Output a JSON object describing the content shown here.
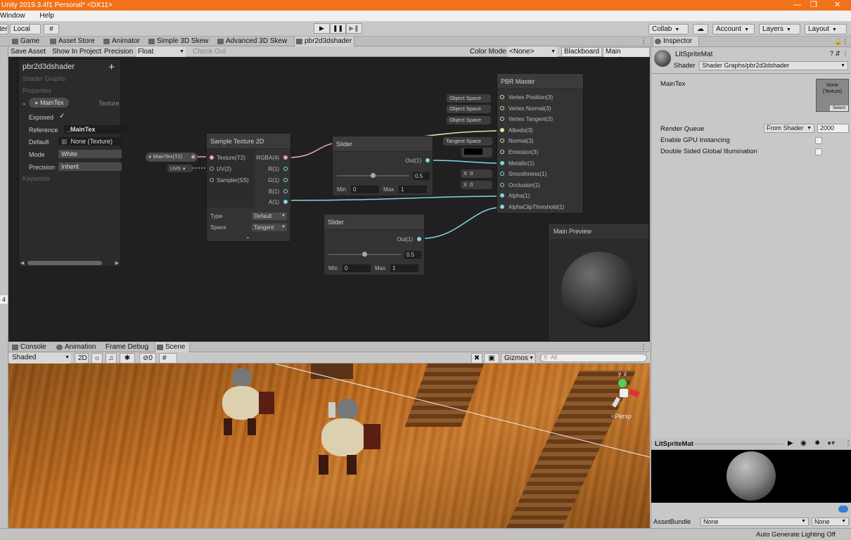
{
  "window": {
    "title": "Unity 2019.3.4f1 Personal* <DX11>"
  },
  "menu": [
    "Window",
    "Help"
  ],
  "toolbar": {
    "left_label": "ter",
    "local": "Local",
    "collab": "Collab",
    "account": "Account",
    "layers": "Layers",
    "layout": "Layout"
  },
  "tabs": [
    "Game",
    "Asset Store",
    "Animator",
    "Simple 3D Skew",
    "Advanced 3D Skew",
    "pbr2d3dshader"
  ],
  "sg_toolbar": {
    "save": "Save Asset",
    "show": "Show In Project",
    "precision_label": "Precision",
    "precision_value": "Float",
    "checkout": "Check Out",
    "color_mode_label": "Color Mode",
    "color_mode_value": "<None>",
    "blackboard": "Blackboard",
    "main_preview": "Main Preview"
  },
  "blackboard": {
    "title": "pbr2d3dshader",
    "subtitle": "Shader Graphs",
    "section": "Properties",
    "property_name": "MainTex",
    "property_type": "Texture",
    "exposed_label": "Exposed",
    "reference_label": "Reference",
    "reference_value": "_MainTex",
    "default_label": "Default",
    "default_value": "None (Texture)",
    "mode_label": "Mode",
    "mode_value": "White",
    "precision_label": "Precision",
    "precision_value": "Inherit",
    "keywords": "Keywords"
  },
  "nodes": {
    "maintex_pill": "MainTex(T2)",
    "uv_pill": "UV0",
    "sample": {
      "title": "Sample Texture 2D",
      "in": [
        "Texture(T2)",
        "UV(2)",
        "Sampler(SS)"
      ],
      "out": [
        "RGBA(4)",
        "R(1)",
        "G(1)",
        "B(1)",
        "A(1)"
      ],
      "type_label": "Type",
      "type_value": "Default",
      "space_label": "Space",
      "space_value": "Tangent"
    },
    "slider1": {
      "title": "Slider",
      "out": "Out(1)",
      "value": "0.5",
      "min_label": "Min",
      "min": "0",
      "max_label": "Max",
      "max": "1"
    },
    "slider2": {
      "title": "Slider",
      "out": "Out(1)",
      "value": "0.5",
      "min_label": "Min",
      "min": "0",
      "max_label": "Max",
      "max": "1"
    },
    "master": {
      "title": "PBR Master",
      "ports": [
        "Vertex Position(3)",
        "Vertex Normal(3)",
        "Vertex Tangent(3)",
        "Albedo(3)",
        "Normal(3)",
        "Emission(3)",
        "Metallic(1)",
        "Smoothness(1)",
        "Occlusion(1)",
        "Alpha(1)",
        "AlphaClipThreshold(1)"
      ]
    },
    "space_pills": [
      "Object Space",
      "Object Space",
      "Object Space",
      "Tangent Space"
    ],
    "x_label": "X",
    "x_values": [
      "0",
      "0"
    ]
  },
  "main_preview": {
    "title": "Main Preview"
  },
  "bottom_tabs": [
    "Console",
    "Animation",
    "Frame Debug",
    "Scene"
  ],
  "scene_bar": {
    "shading": "Shaded",
    "mode2d": "2D",
    "hidden_count": "0",
    "gizmos": "Gizmos",
    "search_placeholder": "All"
  },
  "scene": {
    "persp": "Persp",
    "gizmo_y": "y",
    "gizmo_z": "z"
  },
  "inspector": {
    "tab": "Inspector",
    "material_name": "LitSpriteMat",
    "shader_label": "Shader",
    "shader_value": "Shader Graphs/pbr2d3dshader",
    "maintex_label": "MainTex",
    "texture_slot": "None (Texture)",
    "texture_select": "Select",
    "render_queue_label": "Render Queue",
    "render_queue_mode": "From Shader",
    "render_queue_value": "2000",
    "gpu_instancing": "Enable GPU Instancing",
    "double_sided": "Double Sided Global Illumination"
  },
  "preview2": {
    "title": "LitSpriteMat",
    "assetbundle_label": "AssetBundle",
    "assetbundle_value": "None",
    "variant_value": "None"
  },
  "status": {
    "text": "Auto Generate Lighting Off"
  },
  "colors": {
    "accent_title": "#f0731a",
    "graph_bg": "#202020",
    "wire_pink": "#e8a0c8",
    "wire_cyan": "#7fd8e0",
    "wire_yellow": "#e8e0a0"
  }
}
